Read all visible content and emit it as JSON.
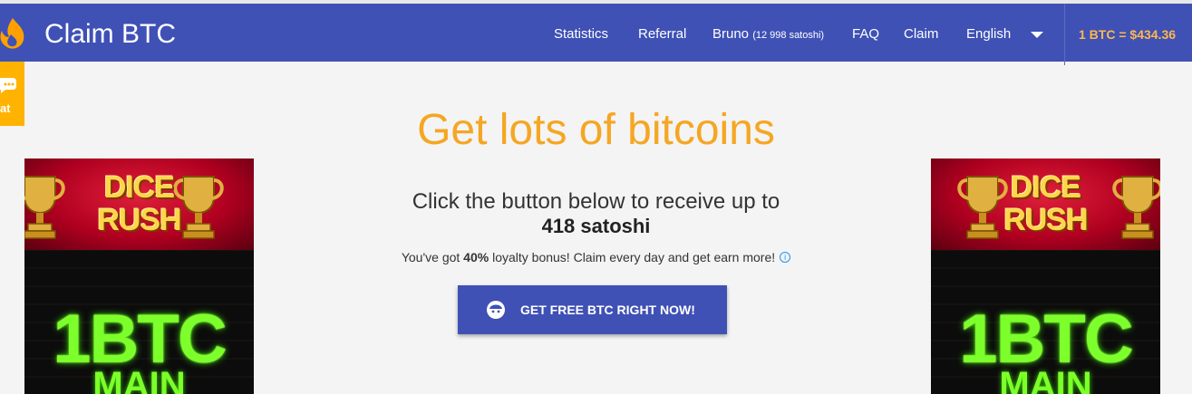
{
  "header": {
    "brand": "Claim BTC",
    "nav": {
      "statistics": "Statistics",
      "referral": "Referral",
      "user_name": "Bruno",
      "user_balance": "(12 998 satoshi)",
      "faq": "FAQ",
      "claim": "Claim",
      "language": "English"
    },
    "price": "1 BTC = $434.36",
    "colors": {
      "bar": "#3f51b5",
      "price": "#ffb74d"
    }
  },
  "chat": {
    "label": "hat",
    "icon": "chat-bubble-icon"
  },
  "main": {
    "headline": "Get lots of bitcoins",
    "line1": "Click the button below to receive up to",
    "line2": "418 satoshi",
    "loyalty_pre": "You've got ",
    "loyalty_pct": "40%",
    "loyalty_post": " loyalty bonus! Claim every day and get earn more!",
    "info_glyph": "i",
    "cta_label": "GET FREE BTC RIGHT NOW!",
    "colors": {
      "headline": "#f5a623",
      "cta": "#3f51b5"
    }
  },
  "ads": {
    "left": {
      "line1": "DICE",
      "line2": "RUSH",
      "big": "1BTC",
      "sub": "MAIN"
    },
    "right": {
      "line1": "DICE",
      "line2": "RUSH",
      "big": "1BTC",
      "sub": "MAIN"
    }
  }
}
